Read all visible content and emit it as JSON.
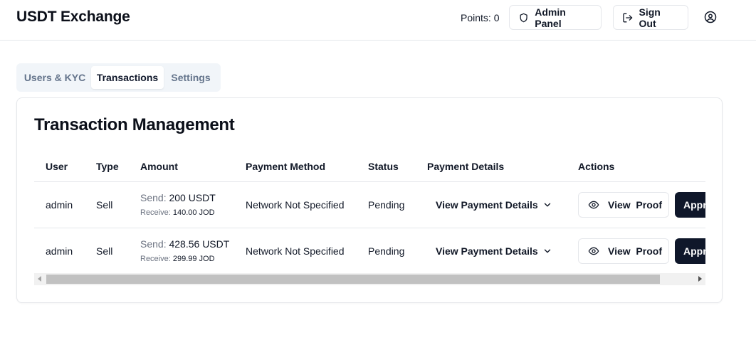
{
  "header": {
    "title": "USDT Exchange",
    "points": "Points: 0",
    "admin_panel": "Admin Panel",
    "sign_out": "Sign Out"
  },
  "tabs": [
    {
      "label": "Users & KYC"
    },
    {
      "label": "Transactions",
      "active": true
    },
    {
      "label": "Settings"
    }
  ],
  "card": {
    "title": "Transaction Management"
  },
  "table": {
    "columns": [
      "User",
      "Type",
      "Amount",
      "Payment Method",
      "Status",
      "Payment Details",
      "Actions"
    ],
    "rows": [
      {
        "user": "admin",
        "type": "Sell",
        "send_label": "Send:",
        "send_value": "200 USDT",
        "receive_label": "Receive:",
        "receive_value": "140.00 JOD",
        "payment_method": "Network Not Specified",
        "status": "Pending",
        "details": "View Payment Details",
        "view_proof": "View  Proof",
        "approve": "Appr"
      },
      {
        "user": "admin",
        "type": "Sell",
        "send_label": "Send:",
        "send_value": "428.56 USDT",
        "receive_label": "Receive:",
        "receive_value": "299.99 JOD",
        "payment_method": "Network Not Specified",
        "status": "Pending",
        "details": "View Payment Details",
        "view_proof": "View  Proof",
        "approve": "Appr"
      }
    ]
  },
  "icons": {
    "admin": "shield-icon",
    "sign_out": "logout-icon",
    "user": "user-circle-icon",
    "details": "chevron-down-icon",
    "proof": "eye-icon"
  },
  "colors": {
    "primary_button": "#0f172a",
    "border": "#e5e7eb",
    "muted_text": "#6b7280"
  }
}
